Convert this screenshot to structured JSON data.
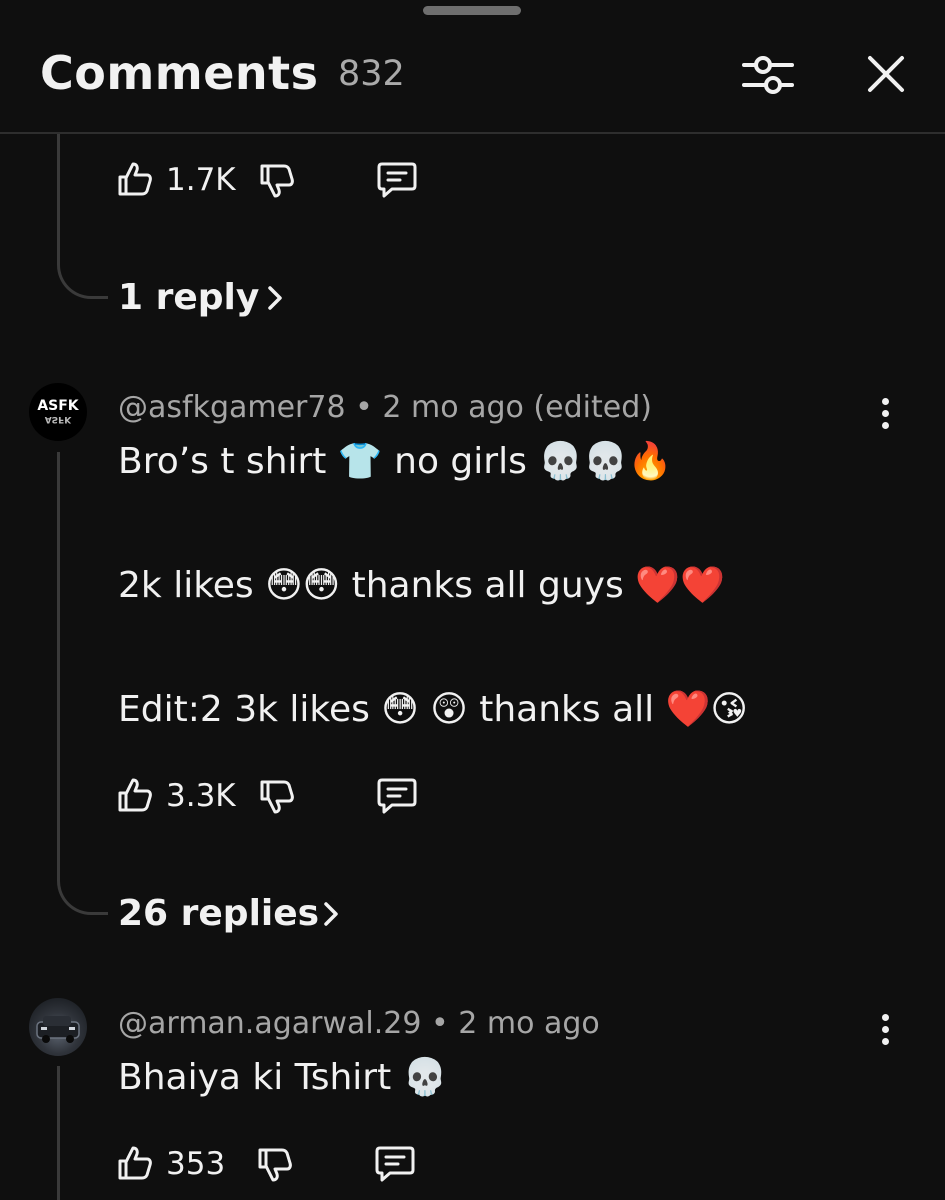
{
  "header": {
    "title": "Comments",
    "count": "832"
  },
  "prev_comment": {
    "likes": "1.7K",
    "replies_label": "1 reply"
  },
  "comments": [
    {
      "avatar_text": "ASFK",
      "author": "@asfkgamer78",
      "separator": "•",
      "time": "2 mo ago (edited)",
      "lines": [
        "Bro’s t shirt 👕 no girls 💀💀🔥",
        "2k likes 😳😳 thanks all guys ❤️❤️",
        "Edit:2 3k likes 😳 😲 thanks all ❤️😘"
      ],
      "likes": "3.3K",
      "replies_label": "26 replies"
    },
    {
      "author": "@arman.agarwal.29",
      "separator": "•",
      "time": "2 mo ago",
      "lines": [
        "Bhaiya ki Tshirt 💀"
      ],
      "likes": "353"
    }
  ],
  "icons": {
    "filter": "sliders-icon",
    "close": "close-icon",
    "like": "thumbs-up-icon",
    "dislike": "thumbs-down-icon",
    "reply": "comment-bubble-icon",
    "more": "kebab-menu-icon",
    "chevron": "chevron-right-icon"
  },
  "colors": {
    "background": "#0f0f0f",
    "text": "#f1f1f1",
    "secondary_text": "#aaaaaa",
    "divider": "#2e2e2e"
  }
}
